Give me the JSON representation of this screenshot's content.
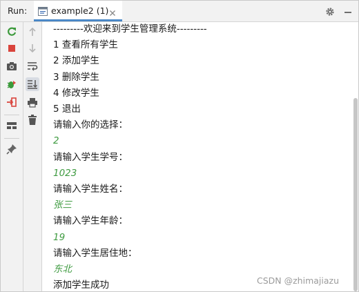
{
  "header": {
    "run_label": "Run:",
    "tab_label": "example2 (1)"
  },
  "toolbar": {
    "left": [
      {
        "name": "rerun-icon"
      },
      {
        "name": "stop-icon"
      },
      {
        "name": "camera-icon"
      },
      {
        "name": "debug-bug-icon"
      },
      {
        "name": "exit-icon"
      },
      {
        "name": "layout-icon"
      },
      {
        "name": "pin-icon"
      }
    ],
    "right": [
      {
        "name": "arrow-up-icon"
      },
      {
        "name": "arrow-down-icon"
      },
      {
        "name": "soft-wrap-icon"
      },
      {
        "name": "scroll-to-end-icon"
      },
      {
        "name": "print-icon"
      },
      {
        "name": "trash-icon"
      }
    ]
  },
  "console": {
    "lines": [
      {
        "text": "---------欢迎来到学生管理系统---------",
        "kind": "output"
      },
      {
        "text": "1 查看所有学生",
        "kind": "output"
      },
      {
        "text": "2 添加学生",
        "kind": "output"
      },
      {
        "text": "3 删除学生",
        "kind": "output"
      },
      {
        "text": "4 修改学生",
        "kind": "output"
      },
      {
        "text": "5 退出",
        "kind": "output"
      },
      {
        "text": "请输入你的选择：",
        "kind": "output"
      },
      {
        "text": "2",
        "kind": "input"
      },
      {
        "text": "请输入学生学号：",
        "kind": "output"
      },
      {
        "text": "1023",
        "kind": "input"
      },
      {
        "text": "请输入学生姓名：",
        "kind": "output"
      },
      {
        "text": "张三",
        "kind": "input"
      },
      {
        "text": "请输入学生年龄：",
        "kind": "output"
      },
      {
        "text": "19",
        "kind": "input"
      },
      {
        "text": "请输入学生居住地：",
        "kind": "output"
      },
      {
        "text": "东北",
        "kind": "input"
      },
      {
        "text": "添加学生成功",
        "kind": "output"
      }
    ]
  },
  "watermark": "CSDN @zhimajiazu",
  "colors": {
    "input_text": "#3f9b41",
    "output_text": "#1a1a1a",
    "tab_underline": "#4a88c7",
    "rerun_green": "#3c9a3c",
    "stop_red": "#d9443c"
  }
}
